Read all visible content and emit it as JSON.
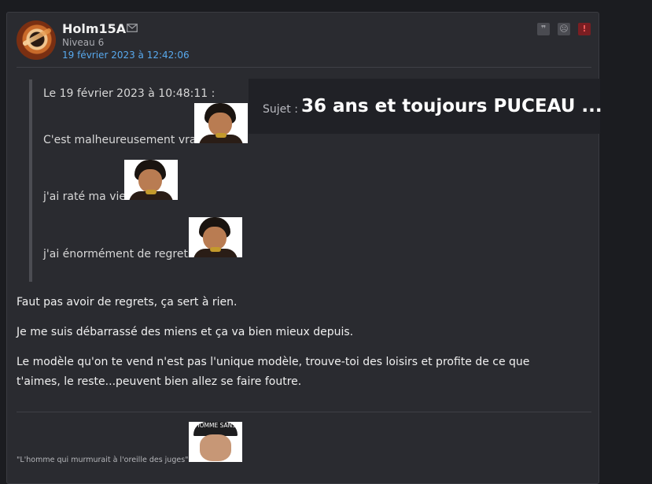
{
  "post": {
    "author": "Holm15A",
    "level": "Niveau 6",
    "date": "19 février 2023 à 12:42:06",
    "icons": {
      "message": "mail-icon",
      "quote": "quote-icon",
      "sad": "sad-face-icon",
      "report": "alert-icon"
    },
    "quote": {
      "header": "Le 19 février 2023 à 10:48:11 :",
      "lines": [
        "C'est malheureusement vrai",
        "j'ai raté ma vie",
        "j'ai énormément de regrets"
      ]
    },
    "paragraphs": [
      "Faut pas avoir de regrets, ça sert à rien.",
      "Je me suis débarrassé des miens et ça va bien mieux depuis.",
      "Le modèle qu'on te vend n'est pas l'unique modèle, trouve-toi des loisirs et profite de ce que t'aimes, le reste...peuvent bien allez se faire foutre."
    ],
    "signature": {
      "text": "\"L'homme qui murmurait à l'oreille des juges\"",
      "image_caption": "HOMME SANS"
    }
  },
  "topic": {
    "label": "Sujet :",
    "title": "36 ans et toujours PUCEAU ..."
  },
  "colors": {
    "date_link": "#58a9ee",
    "report": "#f15b5b",
    "background": "#2a2b30"
  }
}
